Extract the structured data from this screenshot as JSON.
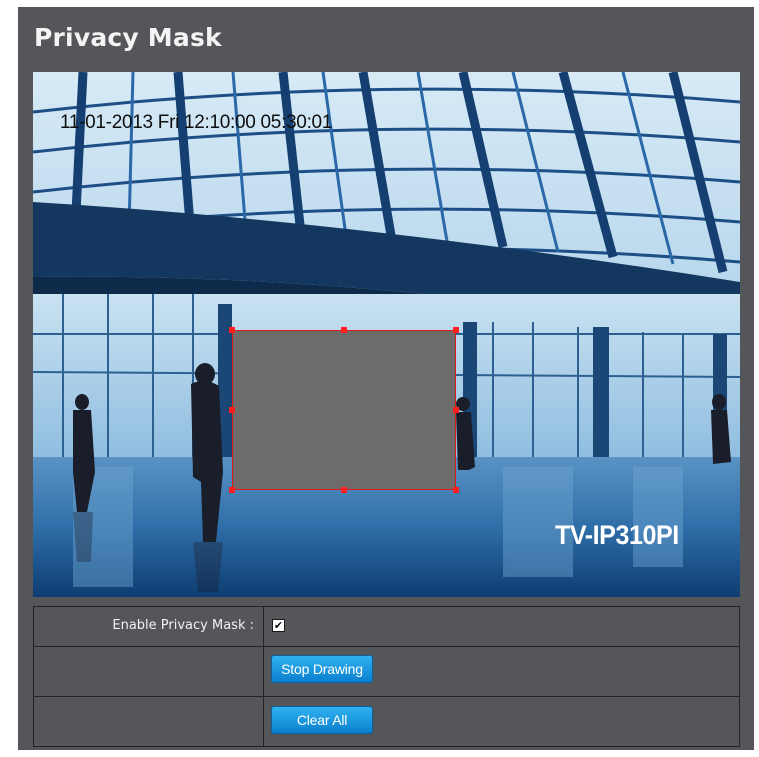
{
  "page": {
    "title": "Privacy Mask"
  },
  "video": {
    "osd_datetime": "11-01-2013 Fri 12:10:00 05:30:01",
    "osd_model": "TV-IP310PI"
  },
  "settings": {
    "enable_label": "Enable Privacy Mask :",
    "enable_checked": true,
    "enable_check_glyph": "✔",
    "stop_drawing_label": "Stop Drawing",
    "clear_all_label": "Clear All"
  },
  "colors": {
    "panel_bg": "#555659",
    "button_blue": "#1595e0",
    "mask_fill": "#6e6c6b",
    "mask_outline": "#e01818"
  }
}
